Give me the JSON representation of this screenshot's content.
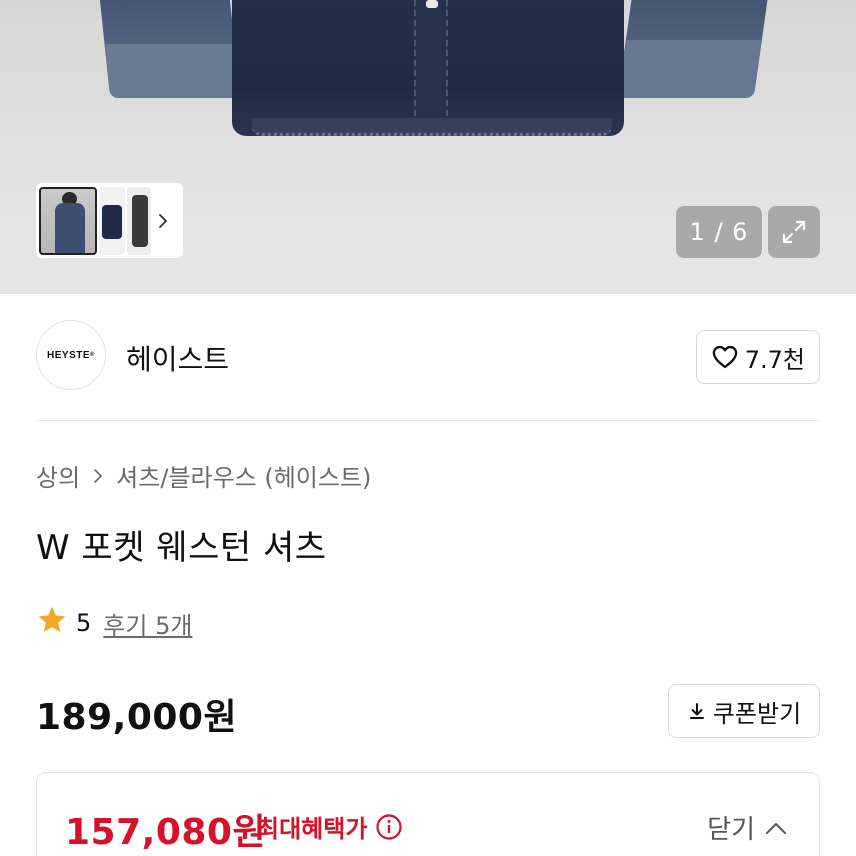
{
  "gallery": {
    "counter": "1 / 6",
    "thumbnails": [
      "model-front",
      "shirt-flat",
      "model-side"
    ],
    "icons": {
      "next": "chevron-right-icon",
      "expand": "expand-icon"
    }
  },
  "brand": {
    "logo_text": "HEYSTE",
    "name": "헤이스트",
    "likes": "7.7천",
    "like_icon": "heart-outline-icon"
  },
  "breadcrumb": {
    "category": "상의",
    "subcategory": "셔츠/블라우스 (헤이스트)"
  },
  "product": {
    "title": "W 포켓 웨스턴 셔츠",
    "rating": "5",
    "reviews": "후기 5개",
    "price": "189,000원",
    "coupon_label": "쿠폰받기"
  },
  "benefit": {
    "price": "157,080원",
    "label": "최대혜택가",
    "toggle_label": "닫기"
  },
  "colors": {
    "accent_red": "#d6112a",
    "star": "#f5a623"
  }
}
